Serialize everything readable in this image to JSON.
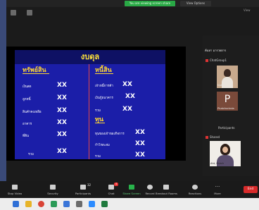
{
  "top_bar": {
    "share_banner": "You are viewing screen share",
    "view_options": "View Options",
    "view_label": "View"
  },
  "slide": {
    "title": "งบดุล",
    "left_header": "ทรัพย์สิน",
    "right_header": "หนี้สิน",
    "equity_header": "ทุน",
    "assets": [
      {
        "label": "เงินสด",
        "value": "XX"
      },
      {
        "label": "ลูกหนี้",
        "value": "XX"
      },
      {
        "label": "สินค้าคงเหลือ",
        "value": "XX"
      },
      {
        "label": "อาคาร",
        "value": "XX"
      },
      {
        "label": "ที่ดิน",
        "value": "XX"
      },
      {
        "label": "รวม",
        "value": "XX"
      }
    ],
    "liabilities": [
      {
        "label": "เจ้าหนี้การค้า",
        "value": "XX"
      },
      {
        "label": "เงินกู้ธนาคาร",
        "value": "XX"
      },
      {
        "label": "รวม",
        "value": "XX"
      }
    ],
    "equity": [
      {
        "label": "ทุนของเจ้าของกิจการ",
        "value": "XX"
      },
      {
        "label": "กำไรสะสม",
        "value": "XX"
      },
      {
        "label": "รวม",
        "value": "XX"
      }
    ]
  },
  "participants": {
    "search_label": "ค้นหา มารวยตาร",
    "rows": [
      "ChatGroup1",
      "Nuth",
      "Phatcharinda"
    ],
    "tile_names": [
      "Nuth",
      "Phatcharinda",
      "Aht, Dutch"
    ],
    "p_initial": "P",
    "section_label": "Participants",
    "presenter_label": "Shared",
    "tile_colors": {
      "photo_bg": "#c7a98d",
      "p_tile": "#7a4a3a"
    }
  },
  "toolbar": {
    "items": [
      "Stop Video",
      "Security",
      "Participants",
      "Chat",
      "Share Screen",
      "Record",
      "Breakout Rooms",
      "Reactions",
      "More"
    ],
    "participants_count": "32",
    "chat_badge": "4",
    "end_label": "End"
  },
  "taskbar": {
    "icon_colors": [
      "#2f6fd6",
      "#e7b428",
      "#d94436",
      "#2b9b58",
      "#3a75d8",
      "#6b6b6b",
      "#2d8cff",
      "#1f7a3e"
    ]
  }
}
